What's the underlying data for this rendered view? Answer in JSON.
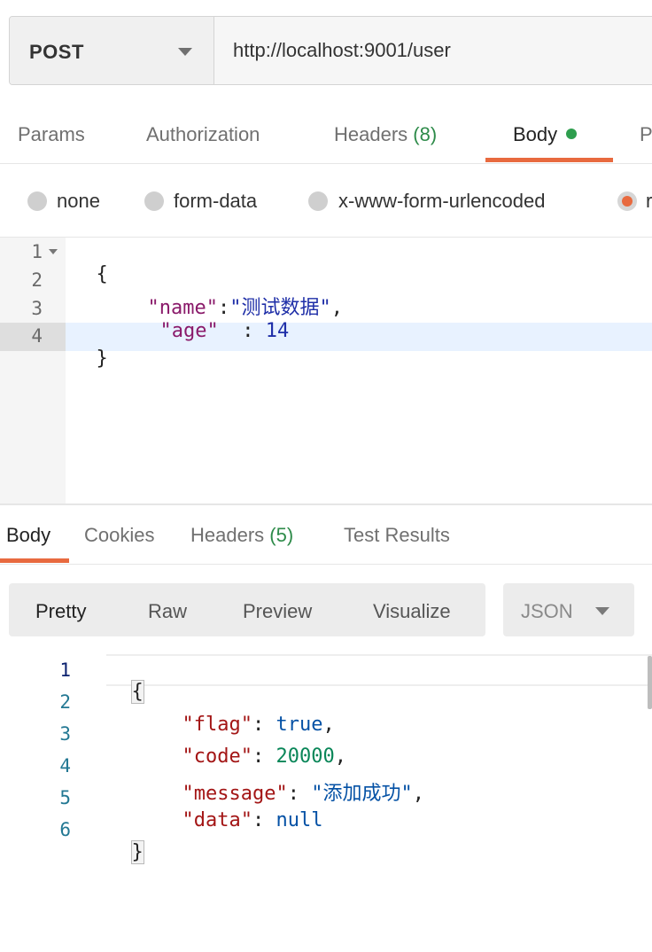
{
  "request": {
    "method": "POST",
    "url": "http://localhost:9001/user"
  },
  "request_tabs": [
    {
      "label": "Params"
    },
    {
      "label": "Authorization"
    },
    {
      "label": "Headers",
      "count": "(8)"
    },
    {
      "label": "Body",
      "active": true
    },
    {
      "label": "P"
    }
  ],
  "body_types": [
    {
      "label": "none",
      "selected": false
    },
    {
      "label": "form-data",
      "selected": false
    },
    {
      "label": "x-www-form-urlencoded",
      "selected": false
    },
    {
      "label": "r",
      "selected": true
    }
  ],
  "request_editor": {
    "line_numbers": [
      "1",
      "2",
      "3",
      "4"
    ],
    "line1_open": "{",
    "name_key": "\"name\"",
    "colon": ":",
    "name_value": "\"测试数据\"",
    "comma": ",",
    "age_key": "\"age\"",
    "age_sep": "  : ",
    "age_value": "14",
    "line4_close": "}"
  },
  "response_tabs": [
    {
      "label": "Body",
      "active": true
    },
    {
      "label": "Cookies"
    },
    {
      "label": "Headers",
      "count": "(5)"
    },
    {
      "label": "Test Results"
    }
  ],
  "view_modes": [
    "Pretty",
    "Raw",
    "Preview",
    "Visualize"
  ],
  "format": "JSON",
  "response_code": {
    "line_numbers": [
      "1",
      "2",
      "3",
      "4",
      "5",
      "6"
    ],
    "open": "{",
    "flag_key": "\"flag\"",
    "flag_value": "true",
    "code_key": "\"code\"",
    "code_value": "20000",
    "message_key": "\"message\"",
    "message_value": "\"添加成功\"",
    "data_key": "\"data\"",
    "data_value": "null",
    "close": "}"
  },
  "colors": {
    "accent": "#e86a3f",
    "status_dot": "#2e9e4e",
    "count_green": "#2e8b4a"
  }
}
